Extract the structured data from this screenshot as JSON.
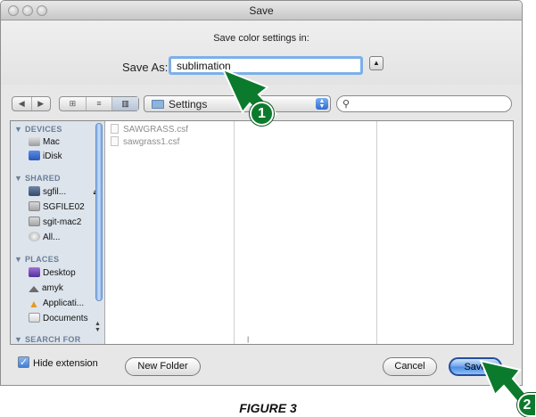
{
  "window": {
    "title": "Save"
  },
  "header": {
    "prompt": "Save color settings in:",
    "save_as_label": "Save As:",
    "save_as_value": "sublimation"
  },
  "toolbar": {
    "location": "Settings",
    "search_value": ""
  },
  "sidebar": {
    "devices_heading": "▼ DEVICES",
    "devices": [
      {
        "label": "Mac",
        "icon": "mac-icon"
      },
      {
        "label": "iDisk",
        "icon": "idisk-icon"
      }
    ],
    "shared_heading": "▼ SHARED",
    "shared": [
      {
        "label": "sgfil...",
        "icon": "network-server-icon"
      },
      {
        "label": "SGFILE02",
        "icon": "server-icon"
      },
      {
        "label": "sgit-mac2",
        "icon": "server-icon"
      },
      {
        "label": "All...",
        "icon": "all-network-icon"
      }
    ],
    "places_heading": "▼ PLACES",
    "places": [
      {
        "label": "Desktop",
        "icon": "desktop-icon"
      },
      {
        "label": "amyk",
        "icon": "home-icon"
      },
      {
        "label": "Applicati...",
        "icon": "applications-icon"
      },
      {
        "label": "Documents",
        "icon": "documents-icon"
      }
    ],
    "search_heading": "▼ SEARCH FOR"
  },
  "files": [
    "SAWGRASS.csf",
    "sawgrass1.csf"
  ],
  "footer": {
    "hide_extension_label": "Hide extension",
    "hide_extension_checked": true,
    "new_folder_label": "New Folder",
    "cancel_label": "Cancel",
    "save_label": "Save"
  },
  "callouts": {
    "one": "1",
    "two": "2"
  },
  "caption": "FIGURE 3",
  "colors": {
    "callout": "#0c7a2c",
    "save_button": "#4b8ae2",
    "focus_ring": "#7cb0e8"
  }
}
